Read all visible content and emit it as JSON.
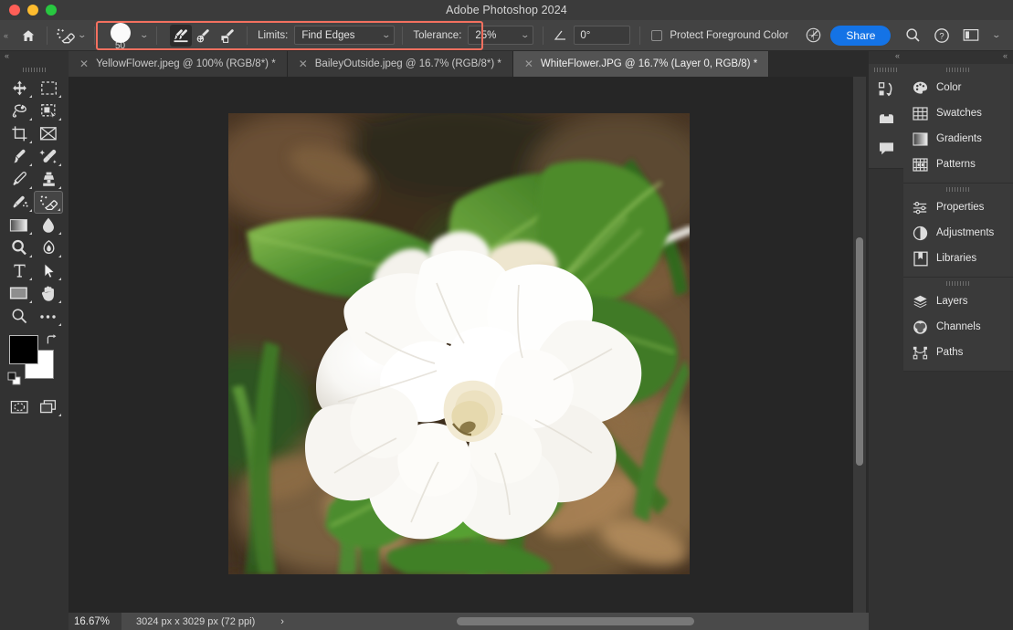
{
  "window": {
    "title": "Adobe Photoshop 2024",
    "controls": [
      "close",
      "minimize",
      "maximize"
    ]
  },
  "options_bar": {
    "collapse_icon": "double-chevron-left-icon",
    "home_icon": "home-icon",
    "tool_icon": "background-eraser-tool-icon",
    "tool_chevron": "chevron-down-icon",
    "brush": {
      "size_label": "50",
      "chevron": "chevron-down-icon"
    },
    "sampling": [
      {
        "name": "sampling-continuous",
        "icon": "eyedropper-continuous-icon",
        "active": true
      },
      {
        "name": "sampling-once",
        "icon": "eyedropper-once-icon",
        "active": false
      },
      {
        "name": "sampling-background-swatch",
        "icon": "eyedropper-background-swatch-icon",
        "active": false
      }
    ],
    "limits": {
      "label": "Limits:",
      "value": "Find Edges",
      "chevron": "chevron-down-icon"
    },
    "tolerance": {
      "label": "Tolerance:",
      "value": "25%",
      "chevron": "chevron-down-icon"
    },
    "angle": {
      "icon": "angle-icon",
      "value": "0°"
    },
    "protect_foreground": {
      "label": "Protect Foreground Color",
      "checked": false
    },
    "pressure_icon": "tablet-pressure-size-icon",
    "share_label": "Share",
    "search_icon": "search-icon",
    "help_icon": "help-circle-icon",
    "workspace_icon": "workspace-switcher-icon",
    "workspace_chevron": "chevron-down-icon",
    "highlight_color": "#f4705f"
  },
  "tabs": [
    {
      "title": "YellowFlower.jpeg @ 100% (RGB/8*) *",
      "active": false,
      "close_icon": "close-icon"
    },
    {
      "title": "BaileyOutside.jpeg @ 16.7% (RGB/8*) *",
      "active": false,
      "close_icon": "close-icon"
    },
    {
      "title": "WhiteFlower.JPG @ 16.7% (Layer 0, RGB/8) *",
      "active": true,
      "close_icon": "close-icon"
    }
  ],
  "toolbar": {
    "collapse_icon": "double-chevron-left-icon",
    "tools": [
      {
        "name": "move-tool",
        "icon": "move-tool-icon",
        "has_flyout": true,
        "selected": false
      },
      {
        "name": "rectangular-marquee-tool",
        "icon": "rectangular-marquee-icon",
        "has_flyout": true,
        "selected": false
      },
      {
        "name": "lasso-tool",
        "icon": "lasso-tool-icon",
        "has_flyout": true,
        "selected": false
      },
      {
        "name": "object-selection-tool",
        "icon": "object-selection-icon",
        "has_flyout": true,
        "selected": false
      },
      {
        "name": "crop-tool",
        "icon": "crop-tool-icon",
        "has_flyout": true,
        "selected": false
      },
      {
        "name": "frame-tool",
        "icon": "frame-tool-icon",
        "has_flyout": false,
        "selected": false
      },
      {
        "name": "eyedropper-tool",
        "icon": "eyedropper-tool-icon",
        "has_flyout": true,
        "selected": false
      },
      {
        "name": "spot-healing-brush-tool",
        "icon": "spot-healing-brush-icon",
        "has_flyout": true,
        "selected": false
      },
      {
        "name": "brush-tool",
        "icon": "brush-tool-icon",
        "has_flyout": true,
        "selected": false
      },
      {
        "name": "clone-stamp-tool",
        "icon": "clone-stamp-icon",
        "has_flyout": true,
        "selected": false
      },
      {
        "name": "history-brush-tool",
        "icon": "history-brush-icon",
        "has_flyout": true,
        "selected": false
      },
      {
        "name": "eraser-tool",
        "icon": "background-eraser-tool-icon",
        "has_flyout": true,
        "selected": true
      },
      {
        "name": "gradient-tool",
        "icon": "gradient-tool-icon",
        "has_flyout": true,
        "selected": false
      },
      {
        "name": "blur-tool",
        "icon": "blur-tool-icon",
        "has_flyout": true,
        "selected": false
      },
      {
        "name": "dodge-tool",
        "icon": "dodge-tool-icon",
        "has_flyout": true,
        "selected": false
      },
      {
        "name": "pen-tool",
        "icon": "pen-tool-icon",
        "has_flyout": true,
        "selected": false
      },
      {
        "name": "type-tool",
        "icon": "type-tool-icon",
        "has_flyout": true,
        "selected": false
      },
      {
        "name": "path-selection-tool",
        "icon": "path-selection-arrow-icon",
        "has_flyout": true,
        "selected": false
      },
      {
        "name": "rectangle-tool",
        "icon": "rectangle-shape-icon",
        "has_flyout": true,
        "selected": false
      },
      {
        "name": "hand-tool",
        "icon": "hand-tool-icon",
        "has_flyout": true,
        "selected": false
      },
      {
        "name": "zoom-tool",
        "icon": "zoom-magnifier-icon",
        "has_flyout": false,
        "selected": false
      },
      {
        "name": "edit-toolbar-tool",
        "icon": "ellipsis-more-tools-icon",
        "has_flyout": true,
        "selected": false
      }
    ],
    "foreground_color": "#000000",
    "background_color": "#ffffff",
    "swap_icon": "swap-colors-icon",
    "default_colors_icon": "default-colors-icon",
    "quick_mask_icon": "quick-mask-mode-icon",
    "screen_mode_icon": "screen-mode-icon"
  },
  "canvas": {
    "document_name": "WhiteFlower.JPG",
    "image_alt": "white gardenia flower with green leaves on forest floor"
  },
  "status_bar": {
    "zoom": "16.67%",
    "doc_dimensions": "3024 px x 3029 px (72 ppi)",
    "expand_icon": "chevron-right-icon"
  },
  "icon_rail": {
    "collapse_icon": "double-chevron-left-icon",
    "items": [
      {
        "name": "history-icon",
        "icon": "history-panel-icon"
      },
      {
        "name": "presets-icon",
        "icon": "presets-panel-icon"
      },
      {
        "name": "comments-icon",
        "icon": "comments-panel-icon"
      }
    ]
  },
  "panels": {
    "collapse_icon": "double-chevron-left-icon",
    "groups": [
      {
        "name": "color-group",
        "items": [
          {
            "label": "Color",
            "icon": "color-palette-icon"
          },
          {
            "label": "Swatches",
            "icon": "swatches-grid-icon"
          },
          {
            "label": "Gradients",
            "icon": "gradients-icon"
          },
          {
            "label": "Patterns",
            "icon": "patterns-icon"
          }
        ]
      },
      {
        "name": "properties-group",
        "items": [
          {
            "label": "Properties",
            "icon": "properties-sliders-icon"
          },
          {
            "label": "Adjustments",
            "icon": "adjustments-halfcircle-icon"
          },
          {
            "label": "Libraries",
            "icon": "libraries-book-icon"
          }
        ]
      },
      {
        "name": "layers-group",
        "items": [
          {
            "label": "Layers",
            "icon": "layers-stack-icon"
          },
          {
            "label": "Channels",
            "icon": "channels-venn-icon"
          },
          {
            "label": "Paths",
            "icon": "paths-bezier-icon"
          }
        ]
      }
    ]
  }
}
